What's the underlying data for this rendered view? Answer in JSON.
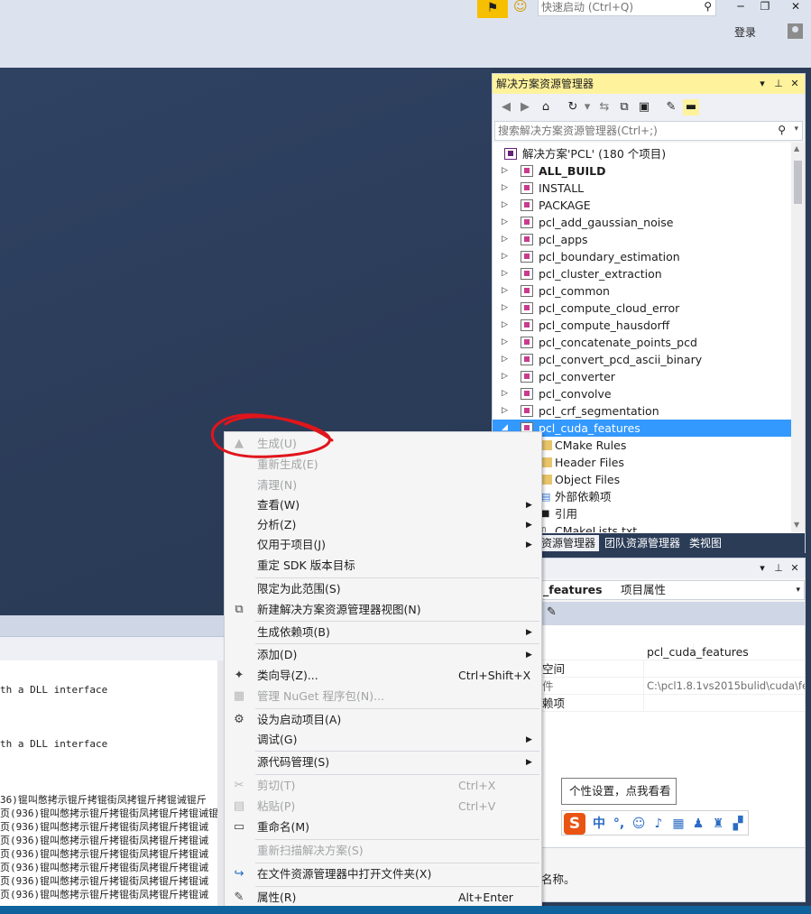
{
  "titlebar": {
    "flag_icon": "flag-icon",
    "smiley_icon": "smiley-icon",
    "quick_launch_placeholder": "快速启动 (Ctrl+Q)",
    "login": "登录",
    "window_buttons": [
      "minimize-icon",
      "restore-icon",
      "close-icon"
    ]
  },
  "output": {
    "lines": [
      "th a DLL interface",
      "th a DLL interface",
      "36)锟叫憋拷示锟斤拷锟街凤拷锟斤拷锟诫锟斤",
      "页(936)锟叫憋拷示锟斤拷锟街凤拷锟斤拷锟诫锟",
      "页(936)锟叫憋拷示锟斤拷锟街凤拷锟斤拷锟诫",
      "页(936)锟叫憋拷示锟斤拷锟街凤拷锟斤拷锟诫",
      "页(936)锟叫憋拷示锟斤拷锟街凤拷锟斤拷锟诫",
      "页(936)锟叫憋拷示锟斤拷锟街凤拷锟斤拷锟诫",
      "页(936)锟叫憋拷示锟斤拷锟街凤拷锟斤拷锟诫",
      "页(936)锟叫憋拷示锟斤拷锟街凤拷锟斤拷锟诫"
    ]
  },
  "solution_explorer": {
    "title": "解决方案资源管理器",
    "search_placeholder": "搜索解决方案资源管理器(Ctrl+;)",
    "solution": "解决方案'PCL' (180 个项目)",
    "items": [
      {
        "label": "ALL_BUILD",
        "bold": true
      },
      {
        "label": "INSTALL"
      },
      {
        "label": "PACKAGE"
      },
      {
        "label": "pcl_add_gaussian_noise"
      },
      {
        "label": "pcl_apps"
      },
      {
        "label": "pcl_boundary_estimation"
      },
      {
        "label": "pcl_cluster_extraction"
      },
      {
        "label": "pcl_common"
      },
      {
        "label": "pcl_compute_cloud_error"
      },
      {
        "label": "pcl_compute_hausdorff"
      },
      {
        "label": "pcl_concatenate_points_pcd"
      },
      {
        "label": "pcl_convert_pcd_ascii_binary"
      },
      {
        "label": "pcl_converter"
      },
      {
        "label": "pcl_convolve"
      },
      {
        "label": "pcl_crf_segmentation"
      },
      {
        "label": "pcl_cuda_features"
      }
    ],
    "children": [
      "CMake Rules",
      "Header Files",
      "Object Files",
      "外部依赖项",
      "引用",
      "CMakeLists.txt"
    ],
    "tabs": [
      "资源管理器",
      "团队资源管理器",
      "类视图"
    ]
  },
  "properties": {
    "object": "_features",
    "object_suffix": "项目属性",
    "rows": [
      {
        "name": "",
        "value": "pcl_cuda_features"
      },
      {
        "name": "空间",
        "value": ""
      },
      {
        "name": "件",
        "value": "C:\\pcl1.8.1vs2015bulid\\cuda\\fe"
      },
      {
        "name": "赖项",
        "value": ""
      }
    ],
    "description": "名称。"
  },
  "ime": {
    "tooltip": "个性设置，点我看看",
    "logo": "S",
    "mode": "中",
    "icons": [
      "punctuation-icon",
      "emoji-icon",
      "mic-icon",
      "keyboard-icon",
      "user-icon",
      "shirt-icon",
      "grid-icon"
    ]
  },
  "context_menu": {
    "items": [
      {
        "label": "生成(U)",
        "disabled": true,
        "icon": "build-icon"
      },
      {
        "label": "重新生成(E)",
        "disabled": true
      },
      {
        "label": "清理(N)",
        "disabled": true
      },
      {
        "label": "查看(W)",
        "submenu": true
      },
      {
        "label": "分析(Z)",
        "submenu": true
      },
      {
        "label": "仅用于项目(J)",
        "submenu": true
      },
      {
        "label": "重定 SDK 版本目标"
      },
      {
        "separator": true
      },
      {
        "label": "限定为此范围(S)"
      },
      {
        "label": "新建解决方案资源管理器视图(N)",
        "icon": "new-view-icon"
      },
      {
        "separator": true
      },
      {
        "label": "生成依赖项(B)",
        "submenu": true
      },
      {
        "separator": true
      },
      {
        "label": "添加(D)",
        "submenu": true
      },
      {
        "label": "类向导(Z)...",
        "shortcut": "Ctrl+Shift+X",
        "icon": "class-wizard-icon"
      },
      {
        "label": "管理 NuGet 程序包(N)...",
        "disabled": true,
        "icon": "nuget-icon"
      },
      {
        "separator": true
      },
      {
        "label": "设为启动项目(A)",
        "icon": "gear-icon"
      },
      {
        "label": "调试(G)",
        "submenu": true
      },
      {
        "separator": true
      },
      {
        "label": "源代码管理(S)",
        "submenu": true
      },
      {
        "separator": true
      },
      {
        "label": "剪切(T)",
        "shortcut": "Ctrl+X",
        "disabled": true,
        "icon": "cut-icon"
      },
      {
        "label": "粘贴(P)",
        "shortcut": "Ctrl+V",
        "disabled": true,
        "icon": "paste-icon"
      },
      {
        "label": "重命名(M)",
        "icon": "rename-icon"
      },
      {
        "separator": true
      },
      {
        "label": "重新扫描解决方案(S)",
        "disabled": true
      },
      {
        "separator": true
      },
      {
        "label": "在文件资源管理器中打开文件夹(X)",
        "icon": "open-folder-icon"
      },
      {
        "separator": true
      },
      {
        "label": "属性(R)",
        "shortcut": "Alt+Enter",
        "icon": "wrench-icon"
      }
    ]
  },
  "colors": {
    "accent_yellow": "#fff29d",
    "selection_blue": "#3399ff",
    "annotation_red": "#e0151b"
  }
}
